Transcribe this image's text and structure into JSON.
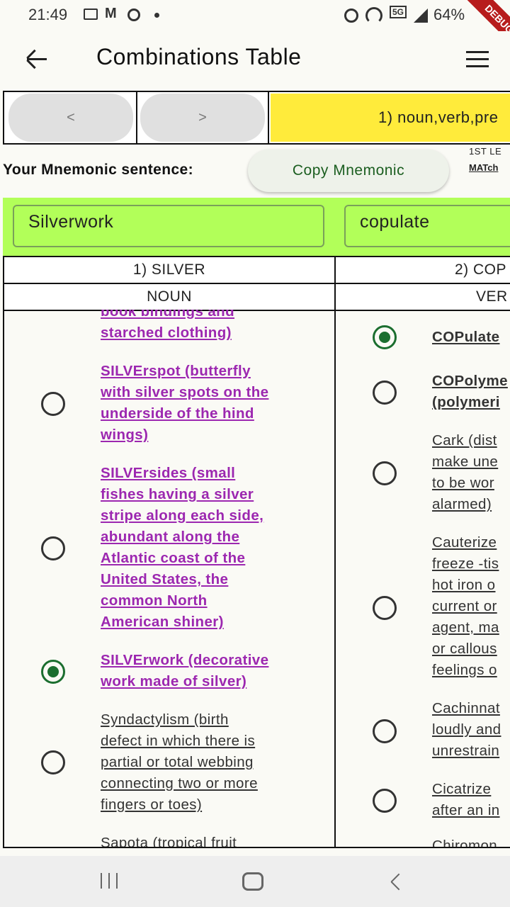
{
  "status_bar": {
    "time": "21:49",
    "battery": "64%",
    "debug_ribbon": "DEBUG"
  },
  "app_bar": {
    "title": "Combinations Table",
    "back_icon": "arrow-left-icon",
    "menu_icon": "hamburger-menu-icon"
  },
  "nav": {
    "prev_label": "<",
    "next_label": ">",
    "combination_label": "1) noun,verb,pre"
  },
  "mnemonic": {
    "label": "Your Mnemonic sentence:",
    "copy_button": "Copy Mnemonic",
    "side_top": "1ST LE",
    "side_bottom": "MATch"
  },
  "words": {
    "word1": "Silverwork",
    "word2": "copulate"
  },
  "columns": [
    {
      "title": "1) SILVER",
      "pos": "NOUN"
    },
    {
      "title": "2) COP",
      "pos": "VER"
    }
  ],
  "col1_items": [
    {
      "text": "book bindings and",
      "style": "sel",
      "selected": null
    },
    {
      "text": "starched clothing)",
      "style": "sel",
      "selected": null
    },
    {
      "lines": [
        "SILVErspot (butterfly",
        "with silver spots on the",
        "underside of the hind",
        "wings)"
      ],
      "style": "sel",
      "selected": false
    },
    {
      "lines": [
        "SILVErsides (small",
        "fishes having a silver",
        "stripe along each side,",
        "abundant along the",
        "Atlantic coast of the",
        "United States, the",
        "common North",
        "American shiner)"
      ],
      "style": "sel",
      "selected": false
    },
    {
      "lines": [
        "SILVErwork (decorative",
        "work made of silver)"
      ],
      "style": "sel",
      "selected": true
    },
    {
      "lines": [
        "Syndactylism (birth",
        "defect in which there is",
        "partial or total webbing",
        "connecting two or more",
        "fingers or toes)"
      ],
      "style": "plain",
      "selected": false
    },
    {
      "lines": [
        "Sapota (tropical fruit"
      ],
      "style": "plain",
      "selected": null
    }
  ],
  "col2_items": [
    {
      "lines": [
        "COPulate"
      ],
      "style": "boldplain",
      "selected": true
    },
    {
      "lines": [
        "COPolyme",
        "(polymeri"
      ],
      "style": "boldplain",
      "selected": false
    },
    {
      "lines": [
        "Cark (dist",
        "make une",
        "to be wor",
        "alarmed)"
      ],
      "style": "plain",
      "selected": false
    },
    {
      "lines": [
        "Cauterize",
        "freeze -tis",
        "hot iron o",
        "current or",
        "agent, ma",
        "or callous",
        "feelings o"
      ],
      "style": "plain",
      "selected": false
    },
    {
      "lines": [
        "Cachinnat",
        "loudly and",
        "unrestrain"
      ],
      "style": "plain",
      "selected": false
    },
    {
      "lines": [
        "Cicatrize",
        "after an in"
      ],
      "style": "plain",
      "selected": false
    },
    {
      "lines": [
        "Chiromon"
      ],
      "style": "plain",
      "selected": null
    }
  ],
  "colors": {
    "accent_yellow": "#ffeb3b",
    "word_bg": "#b2ff59",
    "selected_text": "#9c27b0",
    "radio_on": "#1b6e2f"
  }
}
